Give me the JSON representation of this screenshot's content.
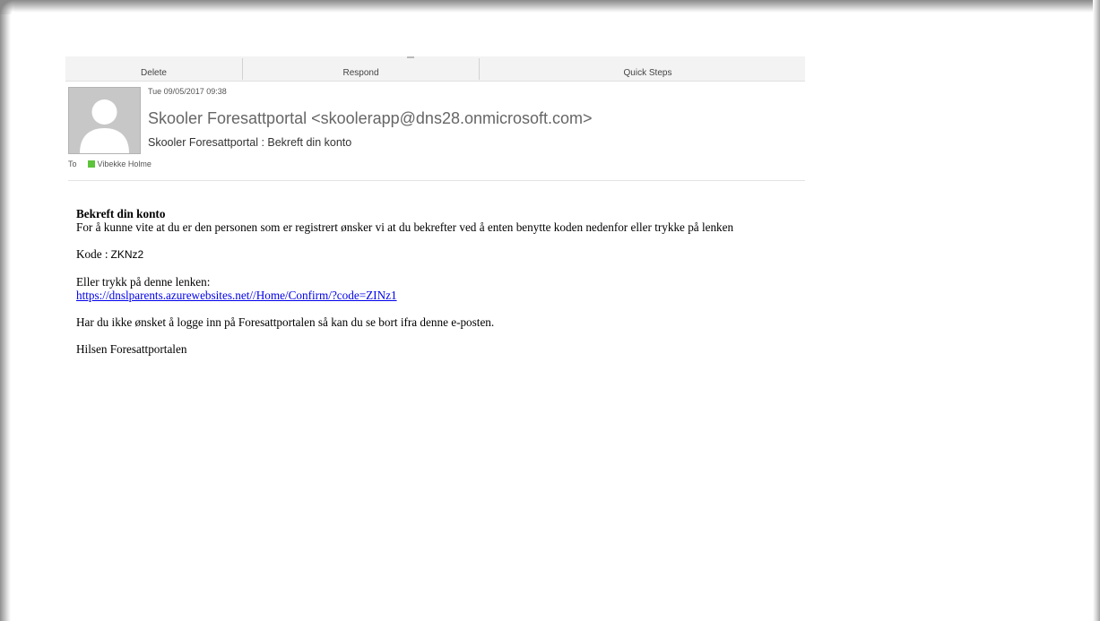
{
  "ribbon": {
    "groups": [
      "Delete",
      "Respond",
      "Quick Steps"
    ]
  },
  "message": {
    "date": "Tue 09/05/2017 09:38",
    "sender": "Skooler Foresattportal <skoolerapp@dns28.onmicrosoft.com>",
    "subject": "Skooler Foresattportal : Bekreft din konto",
    "to_label": "To",
    "recipient": "Vibekke Holme",
    "presence_color": "#5cc33a",
    "avatar_icon": "person-silhouette-icon"
  },
  "body": {
    "heading": "Bekreft din konto",
    "intro": "For å kunne vite at du er den personen som er registrert ønsker vi at du bekrefter ved å enten benytte koden nedenfor eller trykke på lenken",
    "code_label": "Kode :",
    "code_value": "ZKNz2",
    "link_intro": "Eller trykk på denne lenken:",
    "link_text": "https://dnslparents.azurewebsites.net//Home/Confirm/?code=ZINz1",
    "ignore_text": "Har du ikke ønsket å logge inn på Foresattportalen så kan du se bort ifra denne e-posten.",
    "signature": "Hilsen Foresattportalen"
  },
  "colors": {
    "link": "#0000ee",
    "ribbon_bg": "#f3f3f3"
  }
}
